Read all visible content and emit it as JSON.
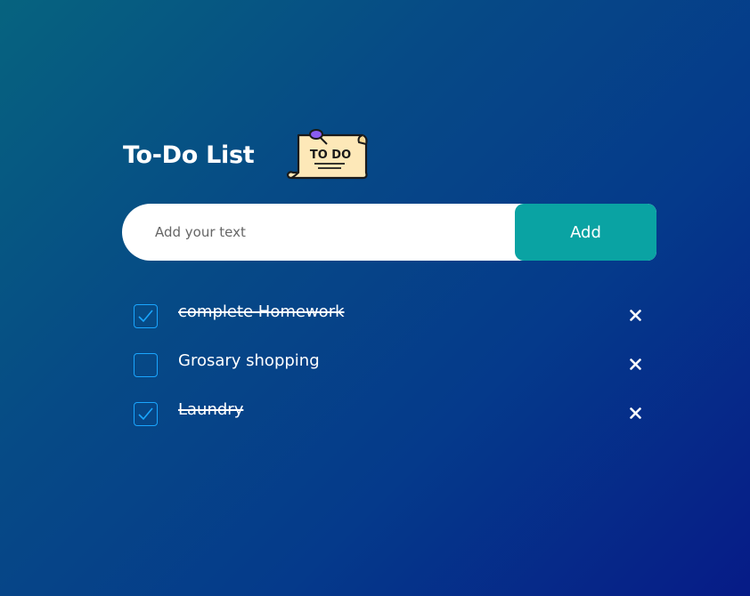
{
  "header": {
    "title": "To-Do List",
    "logo_text": "TO DO",
    "logo_icon": "todo-note-icon"
  },
  "input": {
    "placeholder": "Add your text",
    "value": "",
    "add_label": "Add"
  },
  "tasks": [
    {
      "text": "complete Homework",
      "done": true
    },
    {
      "text": "Grosary shopping",
      "done": false
    },
    {
      "text": "Laundry",
      "done": true
    }
  ],
  "colors": {
    "accent": "#0aa3a3",
    "checkbox_border": "#1aa6ff",
    "background_start": "#06637f",
    "background_end": "#061b87"
  }
}
